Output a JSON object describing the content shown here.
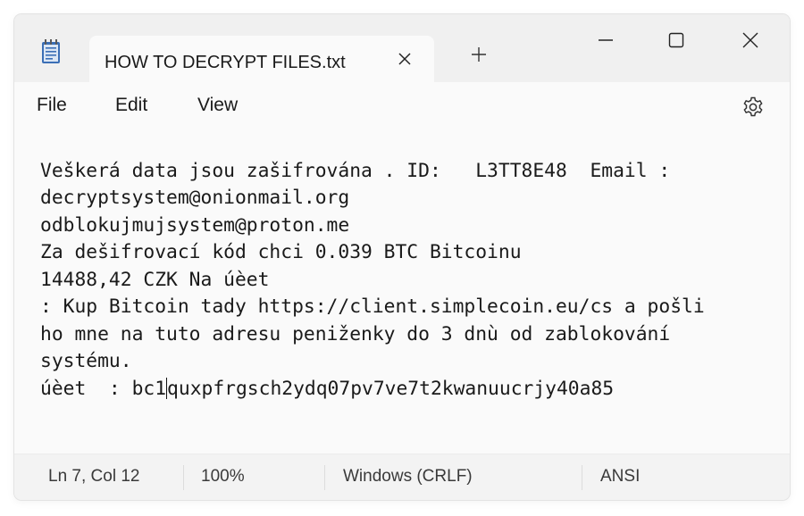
{
  "tab": {
    "title": "HOW TO DECRYPT FILES.txt",
    "app_icon": "notepad-icon",
    "close_icon": "close-icon",
    "new_tab_icon": "plus-icon"
  },
  "window_controls": {
    "minimize_icon": "minimize-icon",
    "maximize_icon": "maximize-icon",
    "close_icon": "close-icon"
  },
  "menu": {
    "items": [
      {
        "label": "File"
      },
      {
        "label": "Edit"
      },
      {
        "label": "View"
      }
    ],
    "settings_icon": "gear-icon"
  },
  "document": {
    "lines": [
      "Veškerá data jsou zašifrována . ID:   L3TT8E48  Email :",
      "decryptsystem@onionmail.org",
      "odblokujmujsystem@proton.me",
      "Za dešifrovací kód chci 0.039 BTC Bitcoinu",
      "14488,42 CZK Na úèet",
      ": Kup Bitcoin tady https://client.simplecoin.eu/cs a pošli",
      "ho mne na tuto adresu peniženky do 3 dnù od zablokování",
      "systému.",
      "úèet  : bc1quxpfrgsch2ydq07pv7ve7t2kwanuucrjy40a85"
    ],
    "last_line_before_caret": "úèet  : bc1",
    "last_line_after_caret": "quxpfrgsch2ydq07pv7ve7t2kwanuucrjy40a85"
  },
  "status": {
    "position": "Ln 7, Col 12",
    "zoom": "100%",
    "line_ending": "Windows (CRLF)",
    "encoding": "ANSI"
  },
  "colors": {
    "window_bg": "#f3f3f3",
    "editor_bg": "#fafafa",
    "text": "#1a1a1a",
    "icon_blue": "#3b6fb6"
  }
}
